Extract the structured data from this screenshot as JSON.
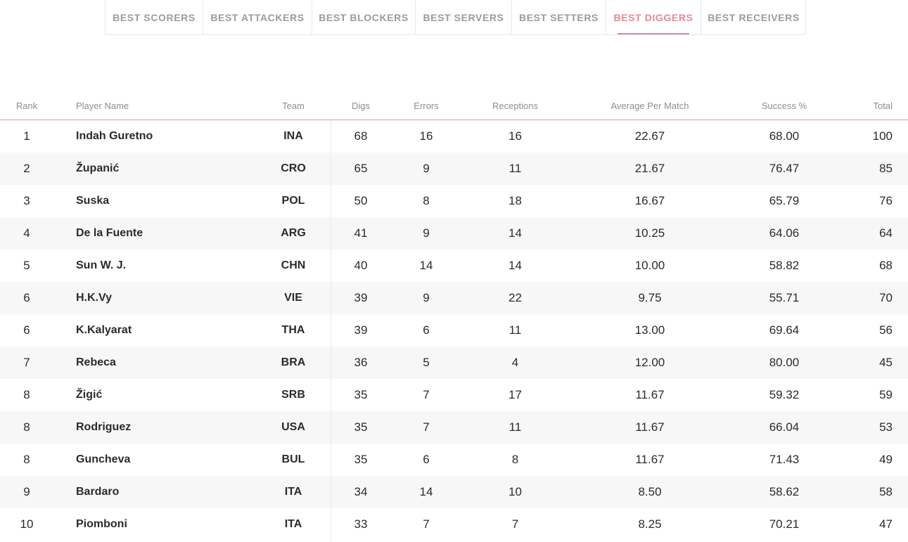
{
  "tabs": [
    {
      "label": "BEST SCORERS",
      "active": false
    },
    {
      "label": "BEST ATTACKERS",
      "active": false
    },
    {
      "label": "BEST BLOCKERS",
      "active": false
    },
    {
      "label": "BEST SERVERS",
      "active": false
    },
    {
      "label": "BEST SETTERS",
      "active": false
    },
    {
      "label": "BEST DIGGERS",
      "active": true
    },
    {
      "label": "BEST RECEIVERS",
      "active": false
    }
  ],
  "colors": {
    "accent": "#e58a92",
    "tab_text": "#9b9b9b",
    "header_text": "#8d8d8d",
    "row_alt": "#f7f7f7",
    "text": "#2b2b2b"
  },
  "table": {
    "columns": [
      "Rank",
      "Player Name",
      "Team",
      "Digs",
      "Errors",
      "Receptions",
      "Average Per Match",
      "Success %",
      "Total"
    ],
    "rows": [
      [
        "1",
        "Indah Guretno",
        "INA",
        "68",
        "16",
        "16",
        "22.67",
        "68.00",
        "100"
      ],
      [
        "2",
        "Županić",
        "CRO",
        "65",
        "9",
        "11",
        "21.67",
        "76.47",
        "85"
      ],
      [
        "3",
        "Suska",
        "POL",
        "50",
        "8",
        "18",
        "16.67",
        "65.79",
        "76"
      ],
      [
        "4",
        "De la Fuente",
        "ARG",
        "41",
        "9",
        "14",
        "10.25",
        "64.06",
        "64"
      ],
      [
        "5",
        "Sun W. J.",
        "CHN",
        "40",
        "14",
        "14",
        "10.00",
        "58.82",
        "68"
      ],
      [
        "6",
        "H.K.Vy",
        "VIE",
        "39",
        "9",
        "22",
        "9.75",
        "55.71",
        "70"
      ],
      [
        "6",
        "K.Kalyarat",
        "THA",
        "39",
        "6",
        "11",
        "13.00",
        "69.64",
        "56"
      ],
      [
        "7",
        "Rebeca",
        "BRA",
        "36",
        "5",
        "4",
        "12.00",
        "80.00",
        "45"
      ],
      [
        "8",
        "Žigić",
        "SRB",
        "35",
        "7",
        "17",
        "11.67",
        "59.32",
        "59"
      ],
      [
        "8",
        "Rodriguez",
        "USA",
        "35",
        "7",
        "11",
        "11.67",
        "66.04",
        "53"
      ],
      [
        "8",
        "Guncheva",
        "BUL",
        "35",
        "6",
        "8",
        "11.67",
        "71.43",
        "49"
      ],
      [
        "9",
        "Bardaro",
        "ITA",
        "34",
        "14",
        "10",
        "8.50",
        "58.62",
        "58"
      ],
      [
        "10",
        "Piomboni",
        "ITA",
        "33",
        "7",
        "7",
        "8.25",
        "70.21",
        "47"
      ]
    ]
  }
}
